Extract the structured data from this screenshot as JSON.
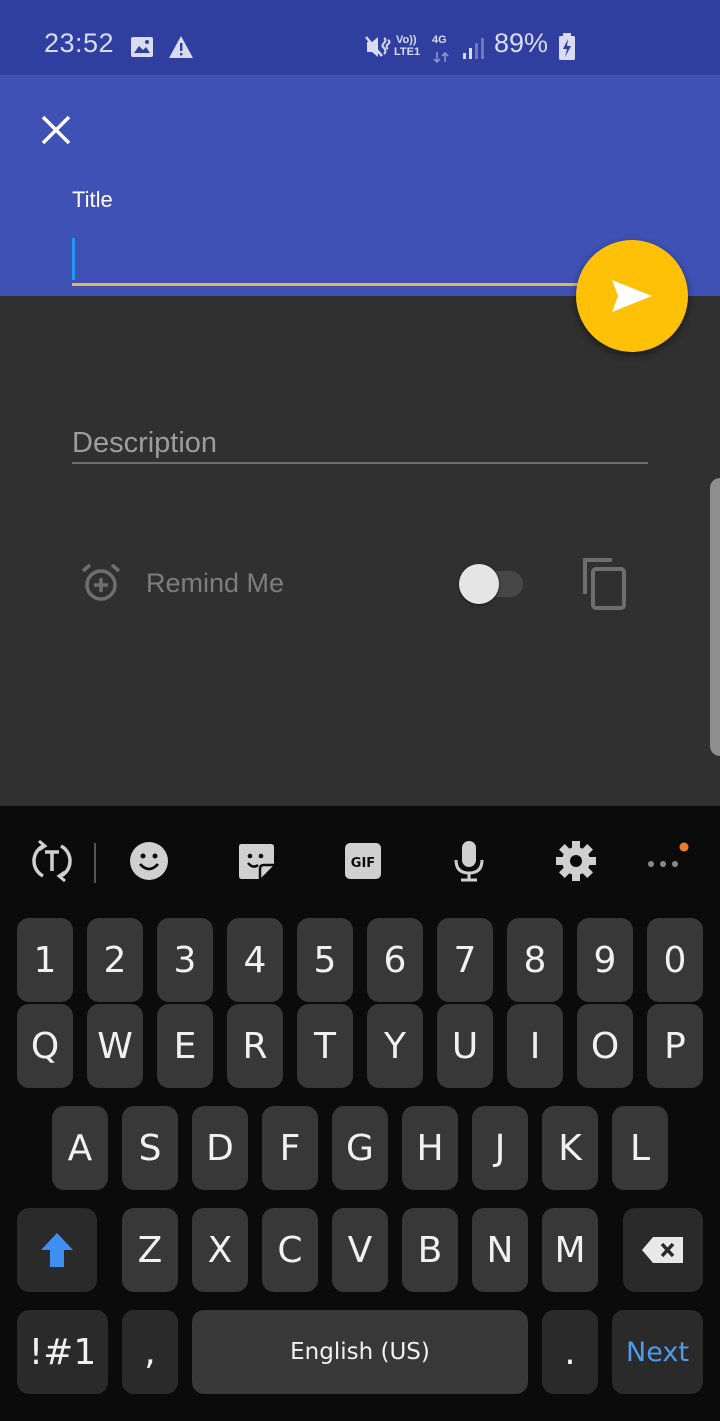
{
  "status_bar": {
    "time": "23:52",
    "notification_icons": [
      "image-icon",
      "warning-icon"
    ],
    "system_icons": [
      "mute-vibrate-icon",
      "volte-lte-icon",
      "network-4g-icon",
      "signal-icon",
      "battery-charging-icon"
    ],
    "volte_top": "Vo))",
    "volte_bottom": "LTE1",
    "network_type": "4G",
    "battery_percent": "89%"
  },
  "header": {
    "close_icon": "close-icon",
    "title_label": "Title",
    "title_value": "",
    "send_icon": "send-icon",
    "colors": {
      "primary": "#3f51b5",
      "primary_dark": "#303f9f",
      "accent": "#ffc107",
      "underline": "#e1b952",
      "caret": "#2196f3"
    }
  },
  "form": {
    "description_placeholder": "Description",
    "description_value": "",
    "remind_label": "Remind Me",
    "remind_icon": "alarm-add-icon",
    "remind_enabled": false,
    "copy_icon": "copy-icon"
  },
  "keyboard": {
    "toolbar": [
      {
        "name": "text-mode-icon"
      },
      {
        "name": "emoji-icon"
      },
      {
        "name": "sticker-icon"
      },
      {
        "name": "gif-icon",
        "label": "GIF"
      },
      {
        "name": "microphone-icon"
      },
      {
        "name": "settings-icon"
      },
      {
        "name": "more-icon",
        "badge": true
      }
    ],
    "number_row": [
      "1",
      "2",
      "3",
      "4",
      "5",
      "6",
      "7",
      "8",
      "9",
      "0"
    ],
    "row1": [
      "Q",
      "W",
      "E",
      "R",
      "T",
      "Y",
      "U",
      "I",
      "O",
      "P"
    ],
    "row2": [
      "A",
      "S",
      "D",
      "F",
      "G",
      "H",
      "J",
      "K",
      "L"
    ],
    "row3": [
      "Z",
      "X",
      "C",
      "V",
      "B",
      "N",
      "M"
    ],
    "symbols_label": "!#1",
    "comma_label": ",",
    "space_label": "English (US)",
    "period_label": ".",
    "action_label": "Next",
    "shift_icon": "shift-icon",
    "backspace_icon": "backspace-icon"
  }
}
